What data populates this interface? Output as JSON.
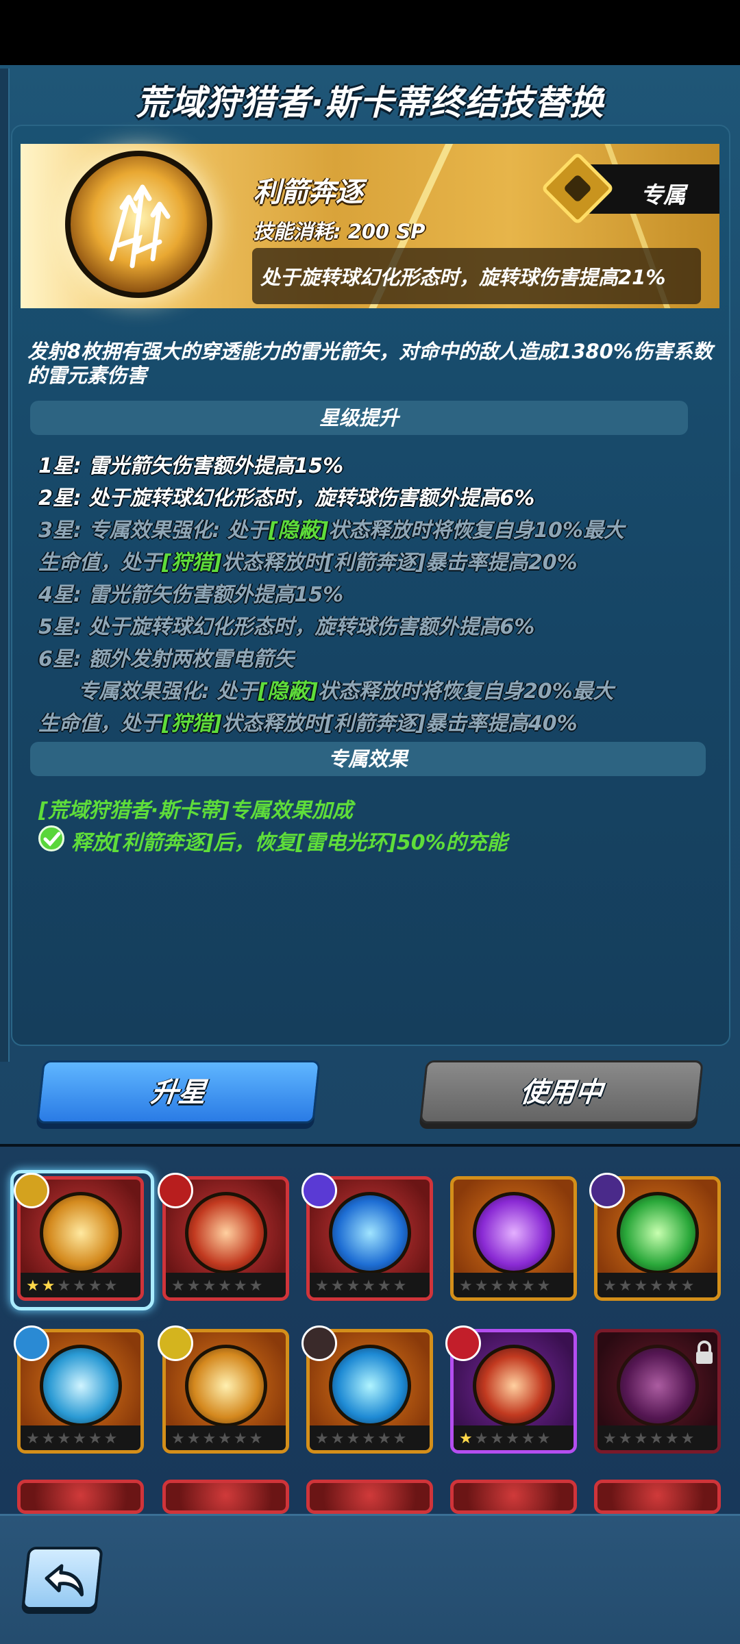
{
  "page_title": "荒域狩猎者·斯卡蒂终结技替换",
  "skill": {
    "name": "利箭奔逐",
    "cost": "技能消耗: 200 SP",
    "bonus": "处于旋转球幻化形态时，旋转球伤害提高21%",
    "exclusive_label": "专属",
    "description": "发射8枚拥有强大的穿透能力的雷光箭矢，对命中的敌人造成1380%伤害系数的雷元素伤害"
  },
  "star_section": {
    "header": "星级提升",
    "lines": [
      {
        "label": "1星:",
        "text": " 雷光箭矢伤害额外提高15%"
      },
      {
        "label": "2星:",
        "text": " 处于旋转球幻化形态时，旋转球伤害额外提高6%"
      },
      {
        "label": "3星:",
        "text_a": " 专属效果强化: 处于",
        "tag_a": "[隐蔽]",
        "text_b": "状态释放时将恢复自身10%最大"
      },
      {
        "text_a": "生命值，处于",
        "tag_a": "[狩猎]",
        "text_b": "状态释放时[利箭奔逐]暴击率提高20%"
      },
      {
        "label": "4星:",
        "text": " 雷光箭矢伤害额外提高15%"
      },
      {
        "label": "5星:",
        "text": " 处于旋转球幻化形态时，旋转球伤害额外提高6%"
      },
      {
        "label": "6星:",
        "text": " 额外发射两枚雷电箭矢"
      },
      {
        "text_a": "专属效果强化: 处于",
        "tag_a": "[隐蔽]",
        "text_b": "状态释放时将恢复自身20%最大"
      },
      {
        "text_a": "生命值，处于",
        "tag_a": "[狩猎]",
        "text_b": "状态释放时[利箭奔逐]暴击率提高40%"
      }
    ]
  },
  "exclusive_section": {
    "header": "专属效果",
    "line1": "[荒域狩猎者·斯卡蒂]专属效果加成",
    "line2": "释放[利箭奔逐]后，恢复[雷电光环]50%的充能"
  },
  "buttons": {
    "upstar": "升星",
    "in_use": "使用中"
  },
  "skill_slots": [
    {
      "name": "lightning-arrows",
      "frame": "red",
      "stars": 2,
      "selected": true,
      "locked": false
    },
    {
      "name": "fire-burst",
      "frame": "red",
      "stars": 0,
      "selected": false,
      "locked": false
    },
    {
      "name": "blue-vortex",
      "frame": "red",
      "stars": 0,
      "selected": false,
      "locked": false
    },
    {
      "name": "purple-flame",
      "frame": "orange",
      "stars": 0,
      "selected": false,
      "locked": false
    },
    {
      "name": "green-blades",
      "frame": "orange",
      "stars": 0,
      "selected": false,
      "locked": false
    },
    {
      "name": "ice-shards",
      "frame": "orange",
      "stars": 0,
      "selected": false,
      "locked": false
    },
    {
      "name": "thunder-bolts",
      "frame": "orange",
      "stars": 0,
      "selected": false,
      "locked": false
    },
    {
      "name": "water-jaws",
      "frame": "orange",
      "stars": 0,
      "selected": false,
      "locked": false
    },
    {
      "name": "fire-spirit",
      "frame": "purple",
      "stars": 1,
      "selected": false,
      "locked": false
    },
    {
      "name": "dark-cauldron",
      "frame": "dark",
      "stars": 0,
      "selected": false,
      "locked": true
    }
  ],
  "colors": {
    "accent_green": "#5fdd3a",
    "button_blue": "#2a7be5",
    "button_gray": "#646464",
    "banner_gold": "#e7b54a"
  }
}
